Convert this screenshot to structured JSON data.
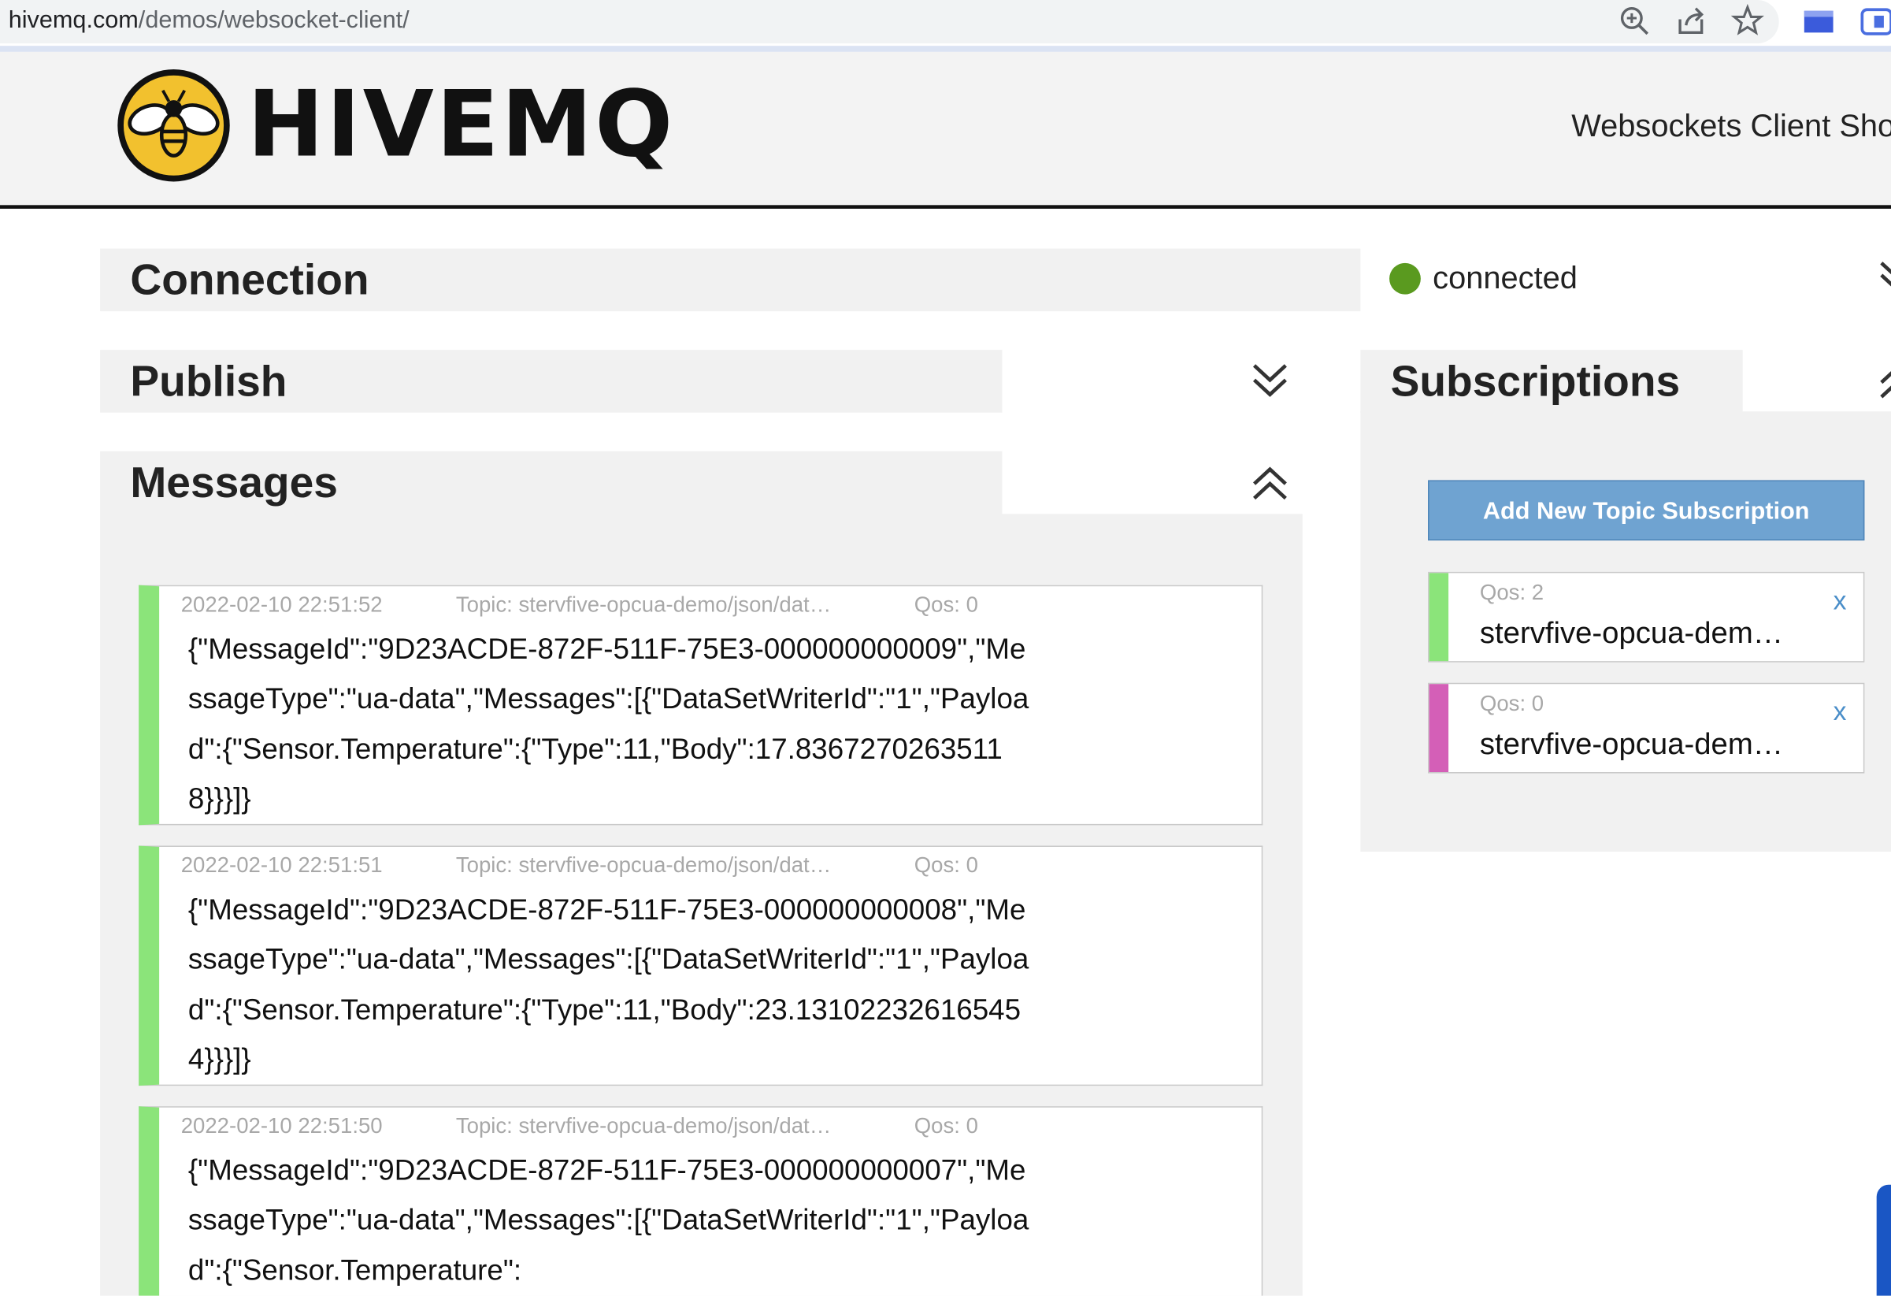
{
  "browser": {
    "url_host": "hivemq.com",
    "url_path": "/demos/websocket-client/"
  },
  "header": {
    "logo_text": "HIVEMQ",
    "tagline": "Websockets Client Sho"
  },
  "connection": {
    "title": "Connection",
    "status": "connected",
    "status_color": "#5a9a1f"
  },
  "publish": {
    "title": "Publish"
  },
  "messages": {
    "title": "Messages",
    "items": [
      {
        "timestamp": "2022-02-10 22:51:52",
        "topic": "Topic: stervfive-opcua-demo/json/dat…",
        "qos": "Qos: 0",
        "payload": "{\"MessageId\":\"9D23ACDE-872F-511F-75E3-000000000009\",\"MessageType\":\"ua-data\",\"Messages\":[{\"DataSetWriterId\":\"1\",\"Payload\":{\"Sensor.Temperature\":{\"Type\":11,\"Body\":17.83672702635118}}}]}",
        "color": "#8be47a"
      },
      {
        "timestamp": "2022-02-10 22:51:51",
        "topic": "Topic: stervfive-opcua-demo/json/dat…",
        "qos": "Qos: 0",
        "payload": "{\"MessageId\":\"9D23ACDE-872F-511F-75E3-000000000008\",\"MessageType\":\"ua-data\",\"Messages\":[{\"DataSetWriterId\":\"1\",\"Payload\":{\"Sensor.Temperature\":{\"Type\":11,\"Body\":23.131022326165454}}}]}",
        "color": "#8be47a"
      },
      {
        "timestamp": "2022-02-10 22:51:50",
        "topic": "Topic: stervfive-opcua-demo/json/dat…",
        "qos": "Qos: 0",
        "payload": "{\"MessageId\":\"9D23ACDE-872F-511F-75E3-000000000007\",\"MessageType\":\"ua-data\",\"Messages\":[{\"DataSetWriterId\":\"1\",\"Payload\":{\"Sensor.Temperature\":",
        "color": "#8be47a"
      }
    ]
  },
  "subscriptions": {
    "title": "Subscriptions",
    "add_button": "Add New Topic Subscription",
    "items": [
      {
        "qos": "Qos: 2",
        "topic": "stervfive-opcua-dem…",
        "remove": "x",
        "color": "#8be47a"
      },
      {
        "qos": "Qos: 0",
        "topic": "stervfive-opcua-dem…",
        "remove": "x",
        "color": "#d45fb7"
      }
    ]
  }
}
